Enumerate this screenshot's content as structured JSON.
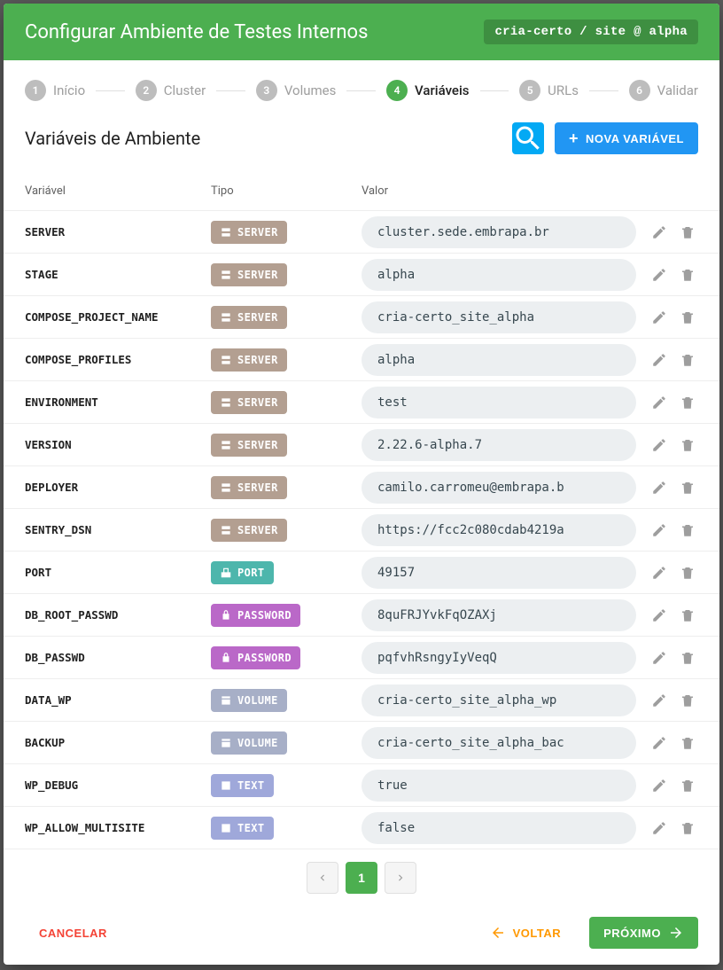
{
  "header": {
    "title": "Configurar Ambiente de Testes Internos",
    "context": "cria-certo / site @ alpha"
  },
  "stepper": [
    {
      "idx": "1",
      "label": "Início",
      "active": false
    },
    {
      "idx": "2",
      "label": "Cluster",
      "active": false
    },
    {
      "idx": "3",
      "label": "Volumes",
      "active": false
    },
    {
      "idx": "4",
      "label": "Variáveis",
      "active": true
    },
    {
      "idx": "5",
      "label": "URLs",
      "active": false
    },
    {
      "idx": "6",
      "label": "Validar",
      "active": false
    }
  ],
  "section": {
    "title": "Variáveis de Ambiente",
    "new_button": "Nova Variável"
  },
  "table": {
    "headers": {
      "variable": "Variável",
      "type": "Tipo",
      "value": "Valor"
    },
    "rows": [
      {
        "name": "SERVER",
        "type": "SERVER",
        "value": "cluster.sede.embrapa.br"
      },
      {
        "name": "STAGE",
        "type": "SERVER",
        "value": "alpha"
      },
      {
        "name": "COMPOSE_PROJECT_NAME",
        "type": "SERVER",
        "value": "cria-certo_site_alpha"
      },
      {
        "name": "COMPOSE_PROFILES",
        "type": "SERVER",
        "value": "alpha"
      },
      {
        "name": "ENVIRONMENT",
        "type": "SERVER",
        "value": "test"
      },
      {
        "name": "VERSION",
        "type": "SERVER",
        "value": "2.22.6-alpha.7"
      },
      {
        "name": "DEPLOYER",
        "type": "SERVER",
        "value": "camilo.carromeu@embrapa.b"
      },
      {
        "name": "SENTRY_DSN",
        "type": "SERVER",
        "value": "https://fcc2c080cdab4219a"
      },
      {
        "name": "PORT",
        "type": "PORT",
        "value": "49157"
      },
      {
        "name": "DB_ROOT_PASSWD",
        "type": "PASSWORD",
        "value": "8quFRJYvkFqOZAXj"
      },
      {
        "name": "DB_PASSWD",
        "type": "PASSWORD",
        "value": "pqfvhRsngyIyVeqQ"
      },
      {
        "name": "DATA_WP",
        "type": "VOLUME",
        "value": "cria-certo_site_alpha_wp"
      },
      {
        "name": "BACKUP",
        "type": "VOLUME",
        "value": "cria-certo_site_alpha_bac"
      },
      {
        "name": "WP_DEBUG",
        "type": "TEXT",
        "value": "true"
      },
      {
        "name": "WP_ALLOW_MULTISITE",
        "type": "TEXT",
        "value": "false"
      }
    ]
  },
  "type_styles": {
    "SERVER": {
      "class": "type-server",
      "icon": "server"
    },
    "PORT": {
      "class": "type-port",
      "icon": "port"
    },
    "PASSWORD": {
      "class": "type-password",
      "icon": "lock"
    },
    "VOLUME": {
      "class": "type-volume",
      "icon": "volume"
    },
    "TEXT": {
      "class": "type-text",
      "icon": "text"
    }
  },
  "pagination": {
    "current": "1"
  },
  "footer": {
    "cancel": "Cancelar",
    "back": "Voltar",
    "next": "Próximo"
  }
}
